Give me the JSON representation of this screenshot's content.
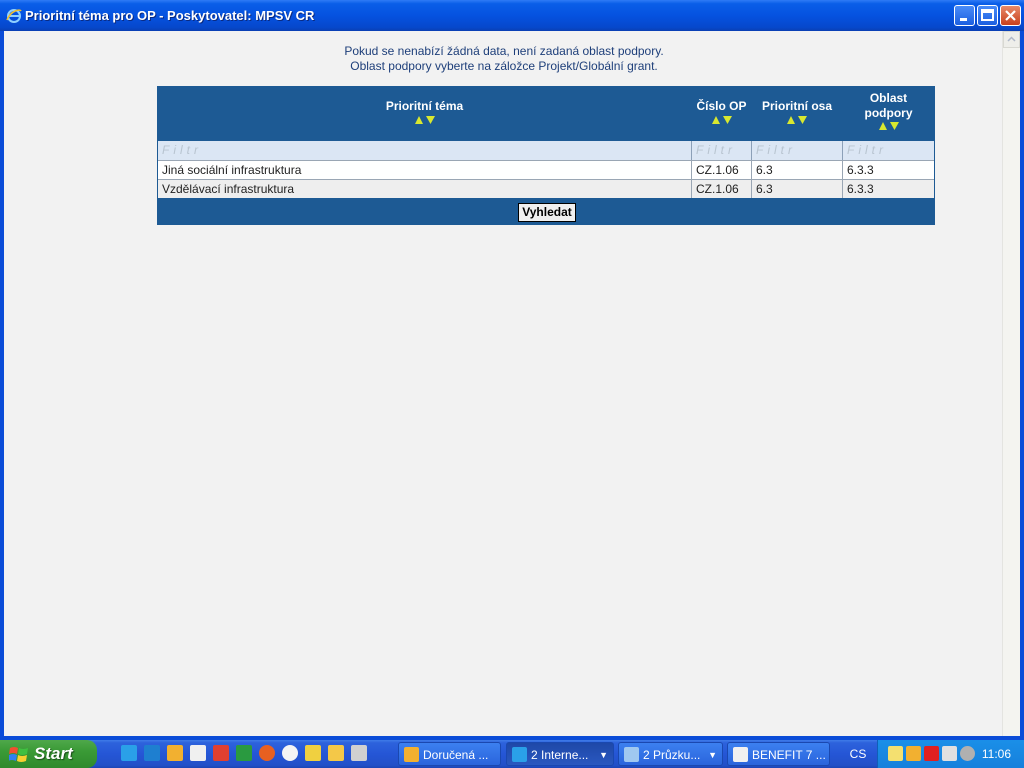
{
  "window": {
    "title": "Prioritní téma pro OP - Poskytovatel: MPSV CR",
    "controls": [
      "minimize-icon",
      "maximize-icon",
      "close-icon"
    ]
  },
  "notice": {
    "line1": "Pokud se nenabízí žádná data, není zadaná oblast podpory.",
    "line2": "Oblast podpory vyberte na záložce Projekt/Globální grant."
  },
  "grid": {
    "columns": [
      {
        "label": "Prioritní téma",
        "label2": ""
      },
      {
        "label": "Číslo OP",
        "label2": ""
      },
      {
        "label": "Prioritní osa",
        "label2": ""
      },
      {
        "label": "Oblast",
        "label2": "podpory"
      }
    ],
    "filter_placeholder": "Filtr",
    "rows": [
      [
        "Jiná sociální infrastruktura",
        "CZ.1.06",
        "6.3",
        "6.3.3"
      ],
      [
        "Vzdělávací infrastruktura",
        "CZ.1.06",
        "6.3",
        "6.3.3"
      ]
    ],
    "search_button": "Vyhledat",
    "colors": {
      "header_bg": "#1d5a94",
      "sort_arrow": "#d8e830",
      "filter_bg": "#dbe6f4"
    }
  },
  "taskbar": {
    "start_label": "Start",
    "quicklaunch": [
      "ie-icon",
      "ie-alt-icon",
      "outlook-icon",
      "word-icon",
      "reader-icon",
      "excel-icon",
      "firefox-icon",
      "media-player-icon",
      "network-icon",
      "folder-icon",
      "tools-icon"
    ],
    "tasks": [
      {
        "label": "Doručená ...",
        "icon": "outlook-icon",
        "dropdown": false,
        "active": false
      },
      {
        "label": "2 Interne...",
        "icon": "ie-icon",
        "dropdown": true,
        "active": true
      },
      {
        "label": "2 Průzku...",
        "icon": "explorer-icon",
        "dropdown": true,
        "active": false
      },
      {
        "label": "BENEFIT 7 ...",
        "icon": "word-icon",
        "dropdown": false,
        "active": false
      }
    ],
    "language": "CS",
    "tray_icons": [
      "mail-icon",
      "clock-icon",
      "antivirus-icon",
      "network-tray-icon",
      "volume-icon"
    ],
    "clock": "11:06"
  }
}
